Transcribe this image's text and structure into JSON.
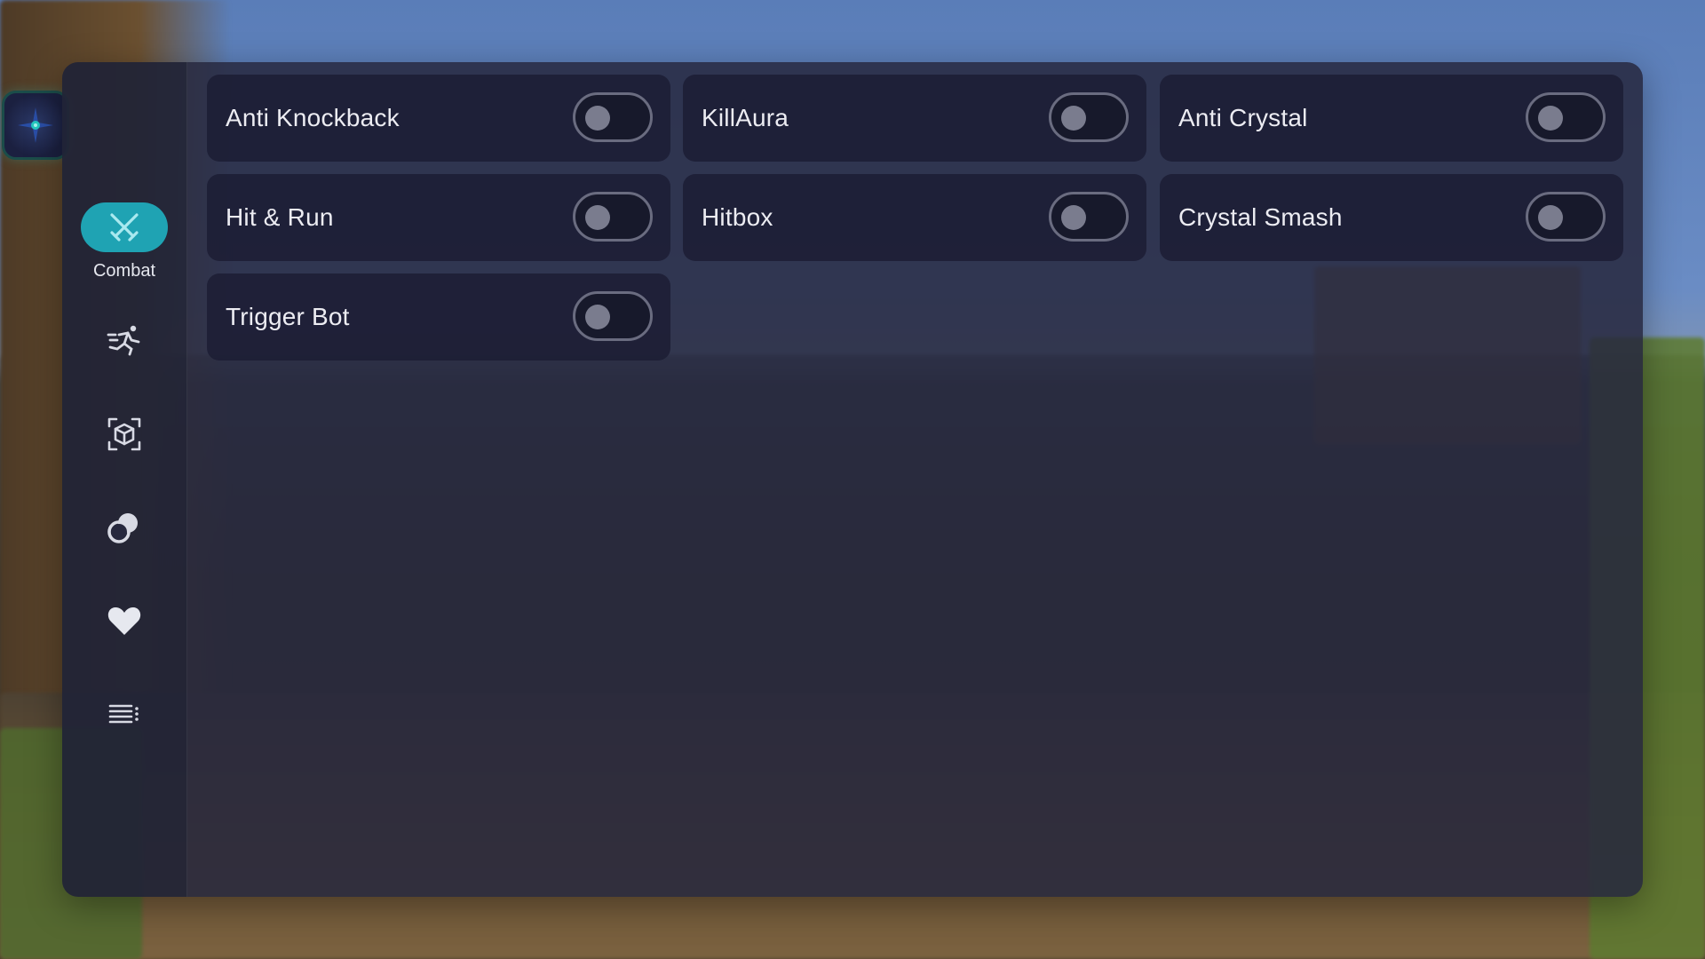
{
  "colors": {
    "accent": "#1fa3b3",
    "panel": "#26283e",
    "card": "#1c1e34",
    "text": "#ececf2",
    "toggle_off": "#7a7c8e"
  },
  "sidebar": {
    "logo_icon": "star-compass-icon",
    "items": [
      {
        "label": "Combat",
        "icon": "crossed-swords-icon",
        "active": true
      },
      {
        "label": "",
        "icon": "running-figure-icon",
        "active": false
      },
      {
        "label": "",
        "icon": "cube-icon",
        "active": false
      },
      {
        "label": "",
        "icon": "orbit-circles-icon",
        "active": false
      },
      {
        "label": "",
        "icon": "heart-icon",
        "active": false
      },
      {
        "label": "",
        "icon": "list-menu-icon",
        "active": false
      }
    ]
  },
  "modules": [
    {
      "label": "Anti Knockback",
      "enabled": false
    },
    {
      "label": "KillAura",
      "enabled": false
    },
    {
      "label": "Anti Crystal",
      "enabled": false
    },
    {
      "label": "Hit & Run",
      "enabled": false
    },
    {
      "label": "Hitbox",
      "enabled": false
    },
    {
      "label": "Crystal Smash",
      "enabled": false
    },
    {
      "label": "Trigger Bot",
      "enabled": false
    }
  ]
}
